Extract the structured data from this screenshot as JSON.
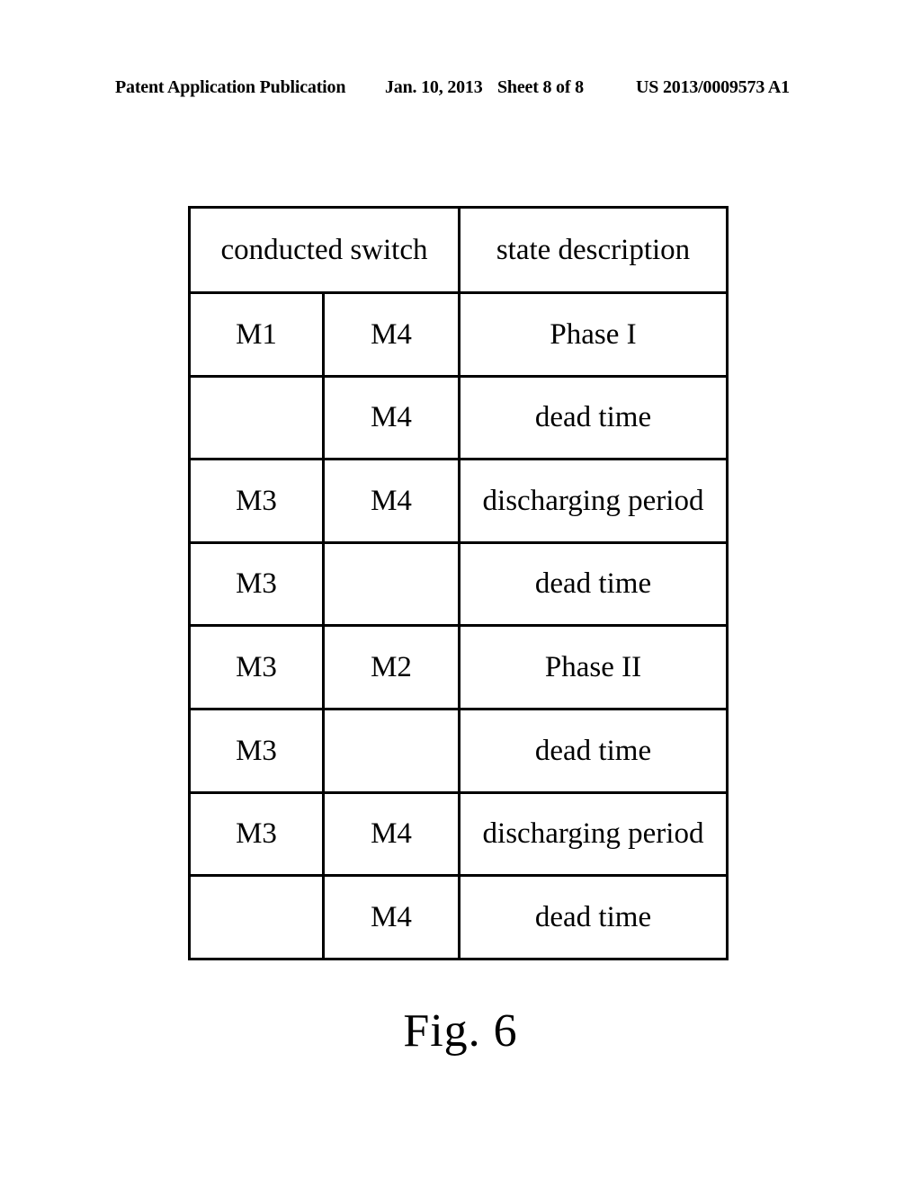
{
  "page_header": {
    "publication": "Patent Application Publication",
    "date": "Jan. 10, 2013",
    "sheet": "Sheet 8 of 8",
    "patent_number": "US 2013/0009573 A1"
  },
  "figure": {
    "caption": "Fig. 6",
    "table": {
      "header": {
        "group_label": "conducted switch",
        "description_label": "state description"
      },
      "rows": [
        {
          "switch_a": "M1",
          "switch_b": "M4",
          "description": "Phase I"
        },
        {
          "switch_a": "",
          "switch_b": "M4",
          "description": "dead time"
        },
        {
          "switch_a": "M3",
          "switch_b": "M4",
          "description": "discharging period"
        },
        {
          "switch_a": "M3",
          "switch_b": "",
          "description": "dead time"
        },
        {
          "switch_a": "M3",
          "switch_b": "M2",
          "description": "Phase II"
        },
        {
          "switch_a": "M3",
          "switch_b": "",
          "description": "dead time"
        },
        {
          "switch_a": "M3",
          "switch_b": "M4",
          "description": "discharging period"
        },
        {
          "switch_a": "",
          "switch_b": "M4",
          "description": "dead time"
        }
      ]
    }
  }
}
